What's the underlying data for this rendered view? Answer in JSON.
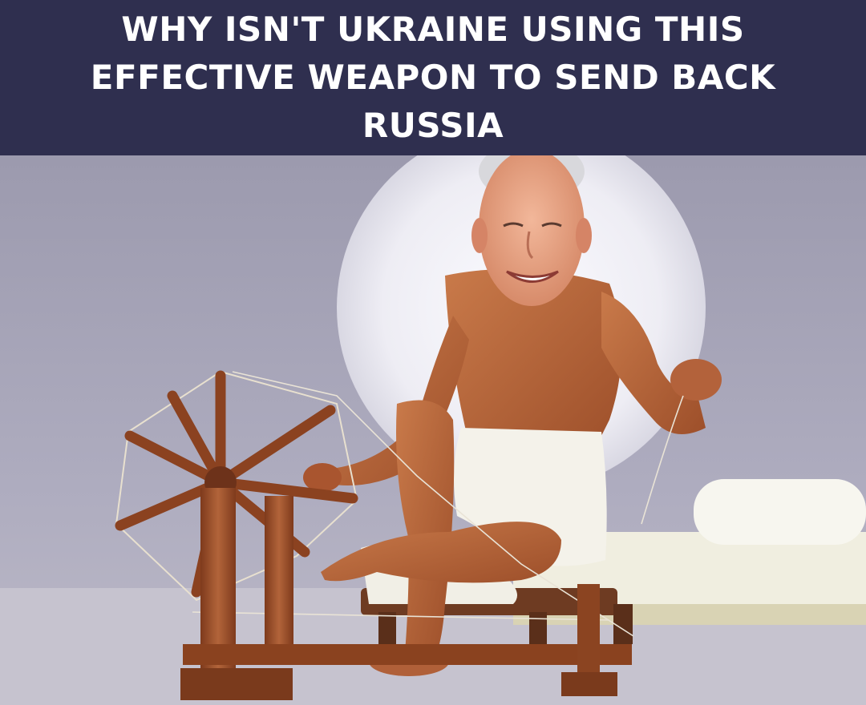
{
  "caption": {
    "text": "WHY ISN'T UKRAINE USING THIS EFFECTIVE WEAPON TO SEND BACK RUSSIA"
  },
  "palette": {
    "caption_bg": "#2f2f4f",
    "caption_text": "#ffffff",
    "backdrop": "#a7a5ba",
    "halo": "#f1f0f6",
    "floor": "#c9c6d2",
    "skin": "#b5653d",
    "wood": "#9a4c28",
    "cloth": "#f3f1ea"
  },
  "icons": [
    "spinning-wheel-icon"
  ]
}
